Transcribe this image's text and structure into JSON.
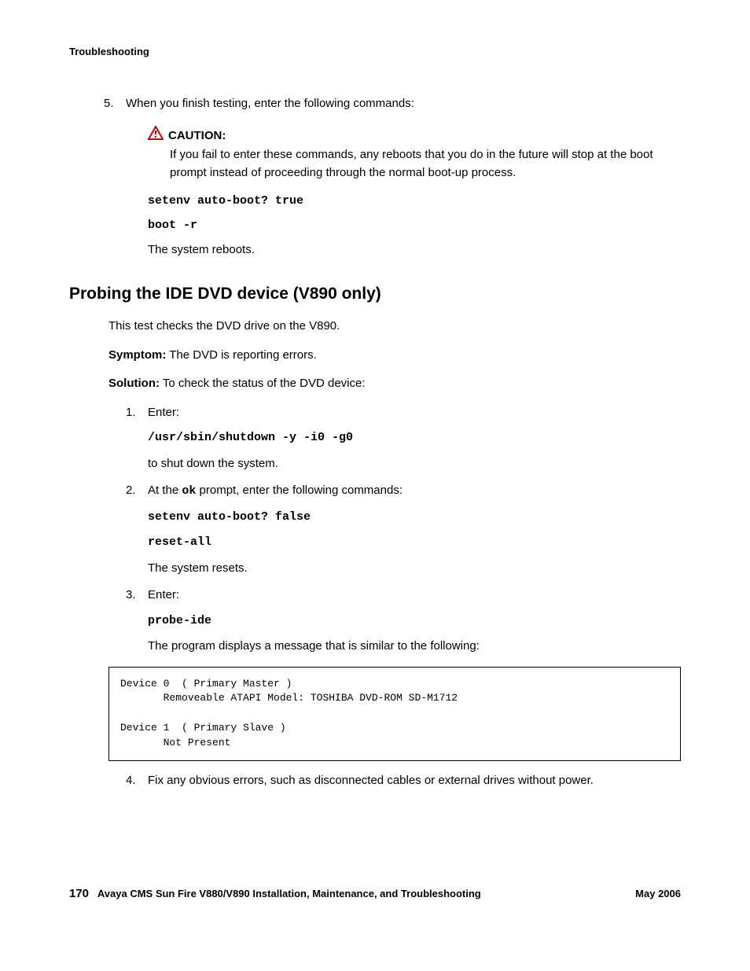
{
  "header": {
    "section": "Troubleshooting"
  },
  "step5": {
    "num": "5",
    "text": "When you finish testing, enter the following commands:",
    "caution_label": "CAUTION:",
    "caution_body": "If you fail to enter these commands, any reboots that you do in the future will stop at the boot prompt instead of proceeding through the normal boot-up process.",
    "cmd1": "setenv auto-boot? true",
    "cmd2": "boot -r",
    "result": "The system reboots."
  },
  "section": {
    "title": "Probing the IDE DVD device (V890 only)",
    "intro": "This test checks the DVD drive on the V890.",
    "symptom_label": "Symptom:",
    "symptom_text": " The DVD is reporting errors.",
    "solution_label": "Solution:",
    "solution_text": " To check the status of the DVD device:"
  },
  "steps": {
    "s1": {
      "num": "1",
      "lead": "Enter:",
      "cmd": "/usr/sbin/shutdown -y -i0 -g0",
      "tail": "to shut down the system."
    },
    "s2": {
      "num": "2",
      "pre": "At the ",
      "ok": "ok",
      "post": " prompt, enter the following commands:",
      "cmd1": "setenv auto-boot? false",
      "cmd2": "reset-all",
      "tail": "The system resets."
    },
    "s3": {
      "num": "3",
      "lead": "Enter:",
      "cmd": "probe-ide",
      "tail": "The program displays a message that is similar to the following:"
    },
    "s4": {
      "num": "4",
      "text": "Fix any obvious errors, such as disconnected cables or external drives without power."
    }
  },
  "output": "Device 0  ( Primary Master )\n       Removeable ATAPI Model: TOSHIBA DVD-ROM SD-M1712\n\nDevice 1  ( Primary Slave )\n       Not Present",
  "footer": {
    "page": "170",
    "title": "Avaya CMS Sun Fire V880/V890 Installation, Maintenance, and Troubleshooting",
    "date": "May 2006"
  }
}
